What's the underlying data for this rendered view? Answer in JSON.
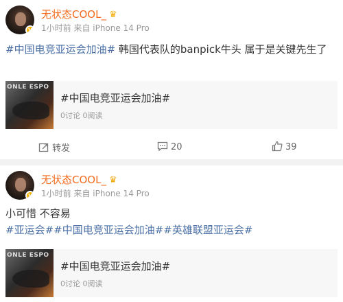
{
  "posts": [
    {
      "user": "无状态COOL_",
      "meta": "1小时前 来自 iPhone 14 Pro",
      "tags": "#中国电竞亚运会加油#",
      "text": " 韩国代表队的banpick牛头 属于是关键先生了",
      "card": {
        "thumb_text": "ONLE ESPO",
        "title": "#中国电竞亚运会加油#",
        "stats": "0讨论 0阅读"
      },
      "actions": {
        "repost": "转发",
        "comments": "20",
        "likes": "39"
      }
    },
    {
      "user": "无状态COOL_",
      "meta": "1小时前 来自 iPhone 14 Pro",
      "text": "小可惜 不容易",
      "tags": "#亚运会##中国电竞亚运会加油##英雄联盟亚运会#",
      "card": {
        "thumb_text": "ONLE ESPO",
        "title": "#中国电竞亚运会加油#",
        "stats": "0讨论 0阅读"
      }
    }
  ],
  "colors": {
    "username": "#f36b1c",
    "hashtag": "#4a6fa5",
    "meta": "#999999",
    "badge": "#f6b400"
  },
  "icons": {
    "verified": "verified-badge-icon",
    "crown": "crown-icon",
    "repost": "repost-icon",
    "comment": "comment-icon",
    "like": "thumbs-up-icon"
  }
}
